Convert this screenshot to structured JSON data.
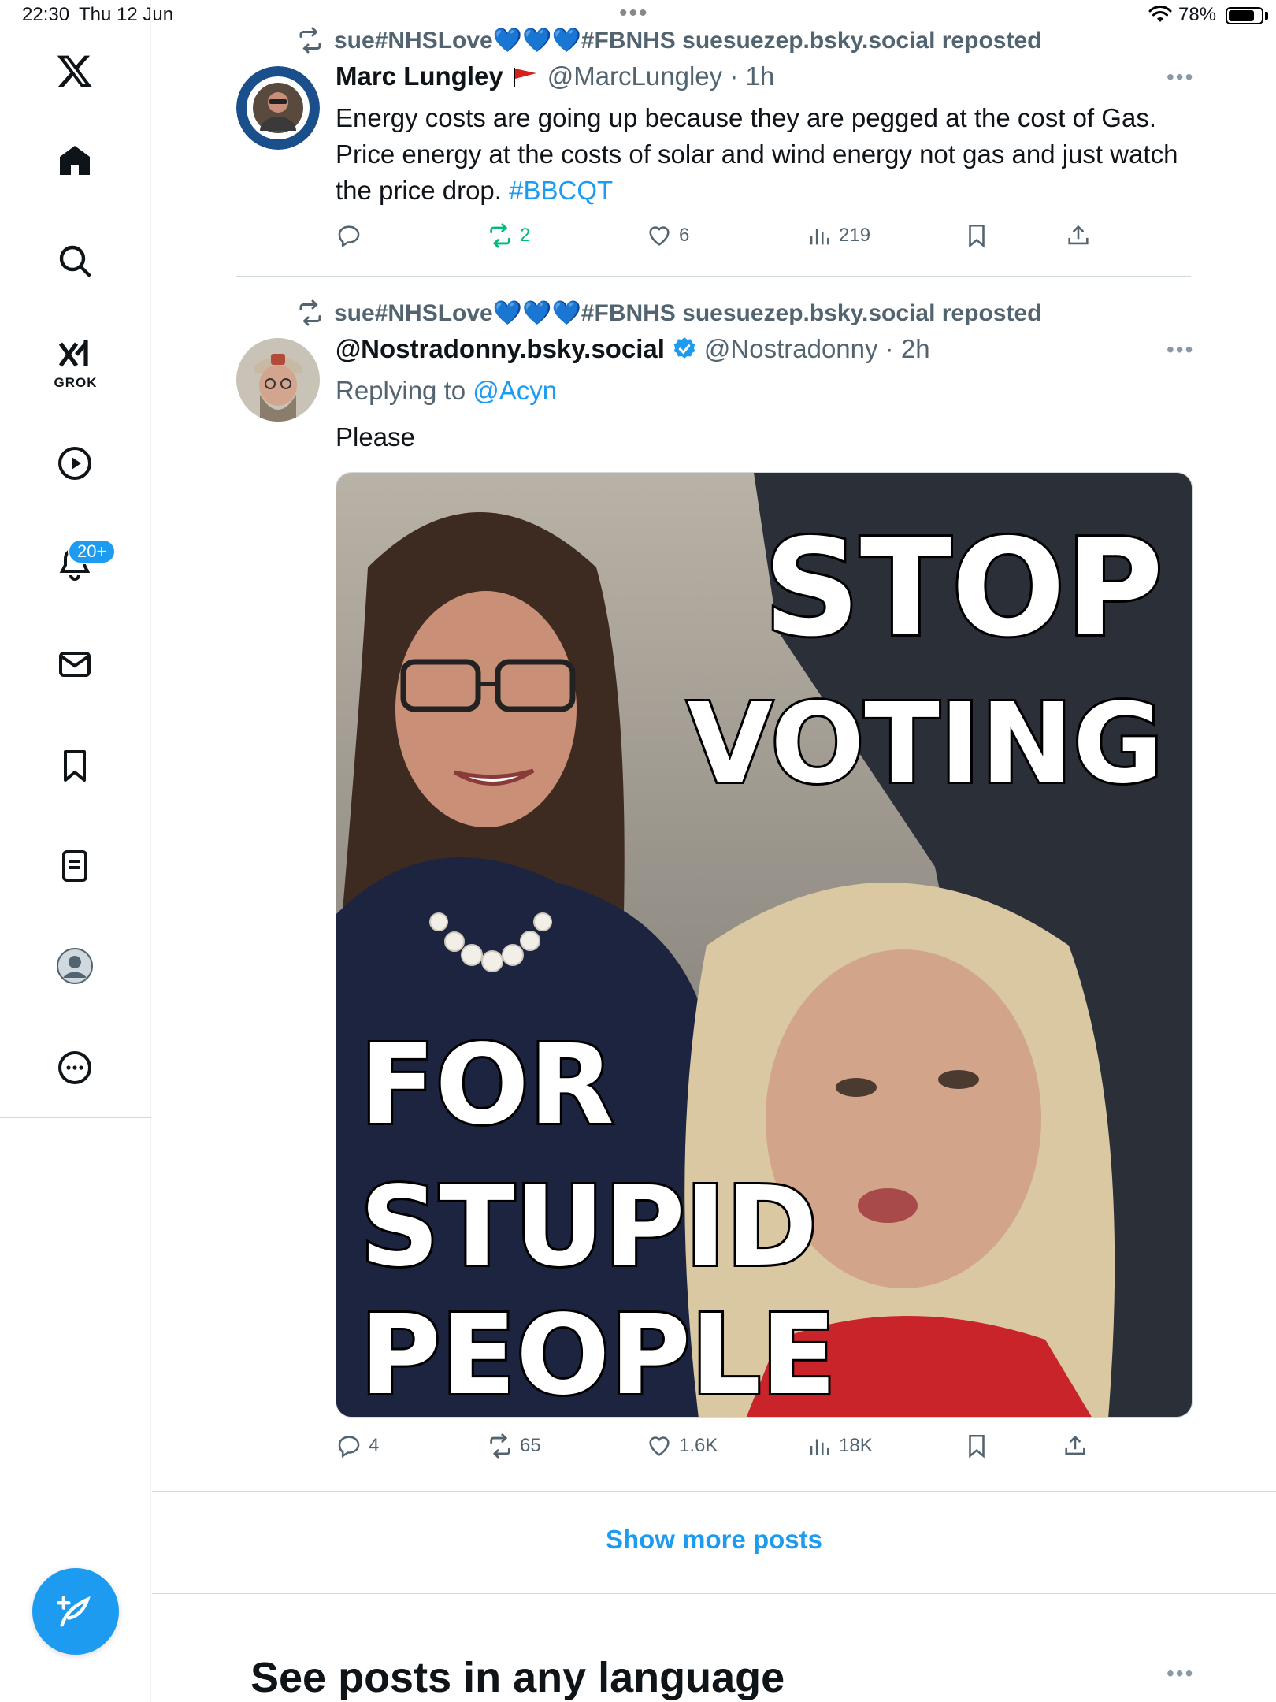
{
  "status_bar": {
    "time": "22:30",
    "date": "Thu 12 Jun",
    "battery": "78%"
  },
  "sidebar": {
    "grok_label": "GROK",
    "notifications_badge": "20+",
    "icons": [
      "x-logo-icon",
      "home-icon",
      "search-icon",
      "grok-icon",
      "video-icon",
      "notifications-icon",
      "messages-icon",
      "bookmarks-icon",
      "lists-icon",
      "profile-icon",
      "more-icon",
      "compose-icon"
    ]
  },
  "tweets": [
    {
      "repost_text": "sue#NHSLove💙💙💙#FBNHS suesuezep.bsky.social reposted",
      "name": "Marc Lungley",
      "handle_time": "@MarcLungley · 1h",
      "text": "Energy costs are going up because they are pegged at the cost of Gas. Price energy at the costs of solar and wind energy not gas and just watch the price drop.",
      "hashtag": "#BBCQT",
      "retweets": "2",
      "likes": "6",
      "views": "219"
    },
    {
      "repost_text": "sue#NHSLove💙💙💙#FBNHS suesuezep.bsky.social reposted",
      "name": "@Nostradonny.bsky.social",
      "handle_time": "@Nostradonny · 2h",
      "replying_prefix": "Replying to ",
      "replying_handle": "@Acyn",
      "text": "Please",
      "media_text": [
        "STOP",
        "VOTING",
        "FOR",
        "STUPID",
        "PEOPLE"
      ],
      "replies": "4",
      "retweets": "65",
      "likes": "1.6K",
      "views": "18K"
    }
  ],
  "show_more": "Show more posts",
  "section_title": "See posts in any language",
  "colors": {
    "accent": "#1d9bf0",
    "retweet_green": "#00ba7c",
    "muted": "#536471"
  }
}
